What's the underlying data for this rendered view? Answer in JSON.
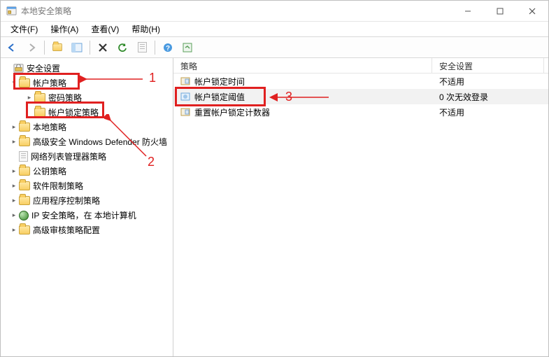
{
  "window": {
    "title": "本地安全策略"
  },
  "menu": {
    "file": {
      "label": "文件(F)"
    },
    "action": {
      "label": "操作(A)"
    },
    "view": {
      "label": "查看(V)"
    },
    "help": {
      "label": "帮助(H)"
    }
  },
  "toolbar": {
    "back": "back",
    "forward": "forward",
    "up": "up",
    "showhide": "showhide",
    "delete": "delete",
    "refresh": "refresh",
    "export": "export",
    "help": "help",
    "props": "props"
  },
  "tree": {
    "root": {
      "label": "安全设置"
    },
    "items": [
      {
        "label": "帐户策略",
        "expanded": true,
        "children": [
          {
            "label": "密码策略"
          },
          {
            "label": "帐户锁定策略"
          }
        ]
      },
      {
        "label": "本地策略"
      },
      {
        "label": "高级安全 Windows Defender 防火墙",
        "truncated": true
      },
      {
        "label": "网络列表管理器策略",
        "leaf": true
      },
      {
        "label": "公钥策略"
      },
      {
        "label": "软件限制策略"
      },
      {
        "label": "应用程序控制策略"
      },
      {
        "label": "IP 安全策略，在 本地计算机",
        "icon": "globe"
      },
      {
        "label": "高级审核策略配置"
      }
    ]
  },
  "list": {
    "columns": {
      "policy": "策略",
      "setting": "安全设置"
    },
    "col_widths": {
      "policy": 370,
      "setting": 160
    },
    "rows": [
      {
        "policy": "帐户锁定时间",
        "setting": "不适用",
        "selected": false
      },
      {
        "policy": "帐户锁定阈值",
        "setting": "0 次无效登录",
        "selected": true
      },
      {
        "policy": "重置帐户锁定计数器",
        "setting": "不适用",
        "selected": false
      }
    ]
  },
  "annotations": {
    "n1": "1",
    "n2": "2",
    "n3": "3"
  }
}
